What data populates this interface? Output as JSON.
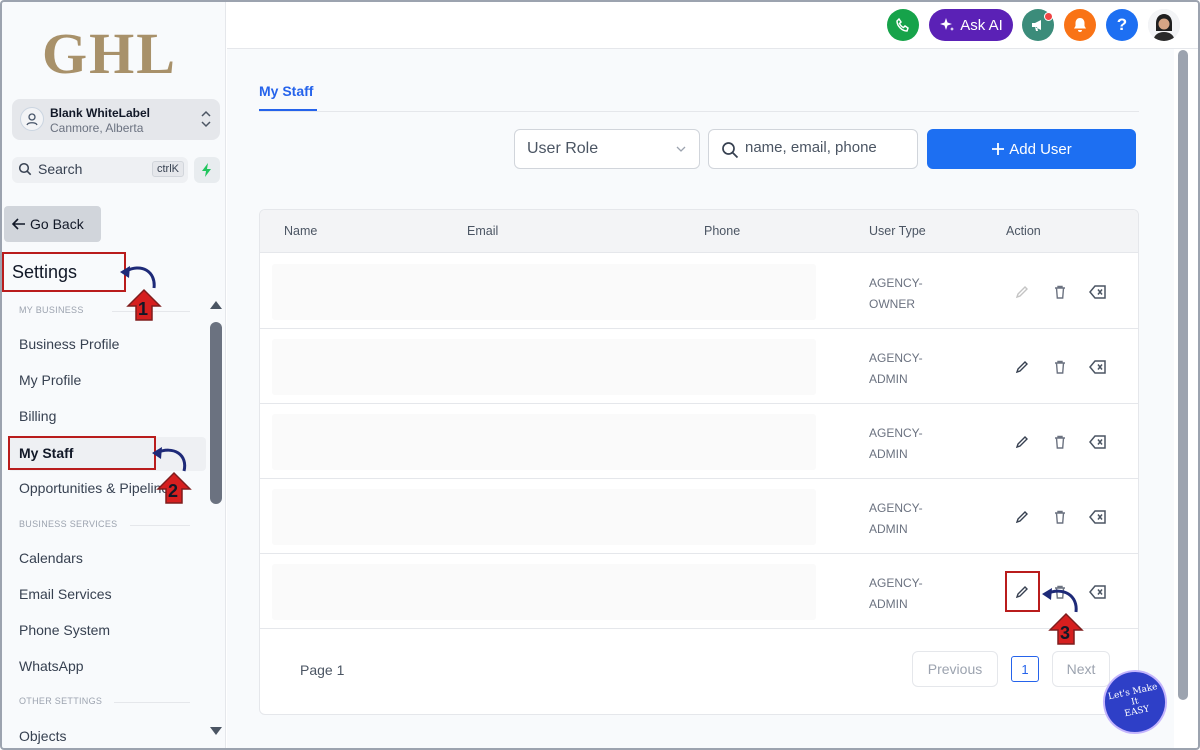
{
  "sidebar": {
    "logo": "GHL",
    "location": {
      "name": "Blank WhiteLabel",
      "sub": "Canmore, Alberta"
    },
    "search": {
      "label": "Search",
      "shortcut": "ctrlK"
    },
    "go_back": "Go Back",
    "title": "Settings",
    "sections": {
      "my_business": "MY BUSINESS",
      "business_services": "BUSINESS SERVICES",
      "other_settings": "OTHER SETTINGS"
    },
    "items": {
      "business_profile": "Business Profile",
      "my_profile": "My Profile",
      "billing": "Billing",
      "my_staff": "My Staff",
      "opportunities": "Opportunities & Pipelines",
      "calendars": "Calendars",
      "email_services": "Email Services",
      "phone_system": "Phone System",
      "whatsapp": "WhatsApp",
      "objects": "Objects"
    },
    "active_item": "My Staff"
  },
  "header": {
    "ask_ai": "Ask AI",
    "icons": [
      "phone-icon",
      "sparkle-icon",
      "megaphone-icon",
      "bell-icon",
      "help-icon",
      "avatar"
    ],
    "colors": {
      "phone": "#16a34a",
      "ask_ai": "#5b21b6",
      "megaphone": "#3b8c7a",
      "bell": "#f97316",
      "help": "#1d6ff2"
    }
  },
  "main": {
    "tab": "My Staff",
    "filters": {
      "user_role_placeholder": "User Role",
      "search_placeholder": "name, email, phone",
      "add_user": "Add User"
    },
    "table": {
      "columns": [
        "Name",
        "Email",
        "Phone",
        "User Type",
        "Action"
      ],
      "rows": [
        {
          "user_type_1": "AGENCY-",
          "user_type_2": "OWNER"
        },
        {
          "user_type_1": "AGENCY-",
          "user_type_2": "ADMIN"
        },
        {
          "user_type_1": "AGENCY-",
          "user_type_2": "ADMIN"
        },
        {
          "user_type_1": "AGENCY-",
          "user_type_2": "ADMIN"
        },
        {
          "user_type_1": "AGENCY-",
          "user_type_2": "ADMIN"
        }
      ]
    },
    "pagination": {
      "page_text": "Page 1",
      "previous": "Previous",
      "current": "1",
      "next": "Next"
    }
  },
  "annotations": {
    "step1": "1",
    "step2": "2",
    "step3": "3"
  },
  "badge": {
    "line1": "Let's Make",
    "line2": "It",
    "line3": "EASY"
  },
  "accent_color": "#1d6ff2",
  "highlight_color": "#b91c1c"
}
